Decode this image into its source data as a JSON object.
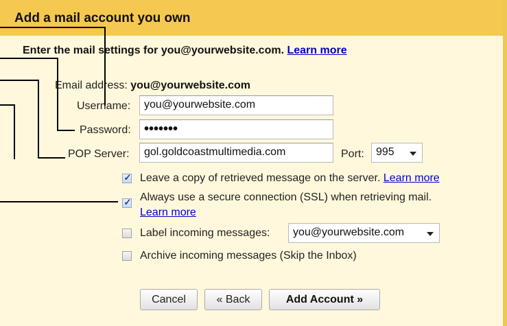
{
  "dialog": {
    "title": "Add a mail account you own",
    "subtitle": "Enter the mail settings for you@yourwebsite.com.",
    "learn_more": "Learn more"
  },
  "form": {
    "email_label": "Email address:",
    "email_value": "you@yourwebsite.com",
    "username_label": "Username:",
    "username_value": "you@yourwebsite.com",
    "password_label": "Password:",
    "password_value": "•••••••",
    "pop_label": "POP Server:",
    "pop_value": "gol.goldcoastmultimedia.com",
    "port_label": "Port:",
    "port_value": "995"
  },
  "options": {
    "leave_copy": {
      "label": "Leave a copy of retrieved message on the server.",
      "link": "Learn more",
      "checked": true
    },
    "ssl": {
      "label": "Always use a secure connection (SSL) when retrieving mail.",
      "link": "Learn more",
      "checked": true
    },
    "label_incoming": {
      "label": "Label incoming messages:",
      "select_value": "you@yourwebsite.com",
      "checked": false
    },
    "archive": {
      "label": "Archive incoming messages (Skip the Inbox)",
      "checked": false
    }
  },
  "buttons": {
    "cancel": "Cancel",
    "back": "« Back",
    "add_account": "Add Account »"
  },
  "colors": {
    "title_bar": "#f5c850",
    "panel": "#fff8dc",
    "link": "#0000cc"
  }
}
